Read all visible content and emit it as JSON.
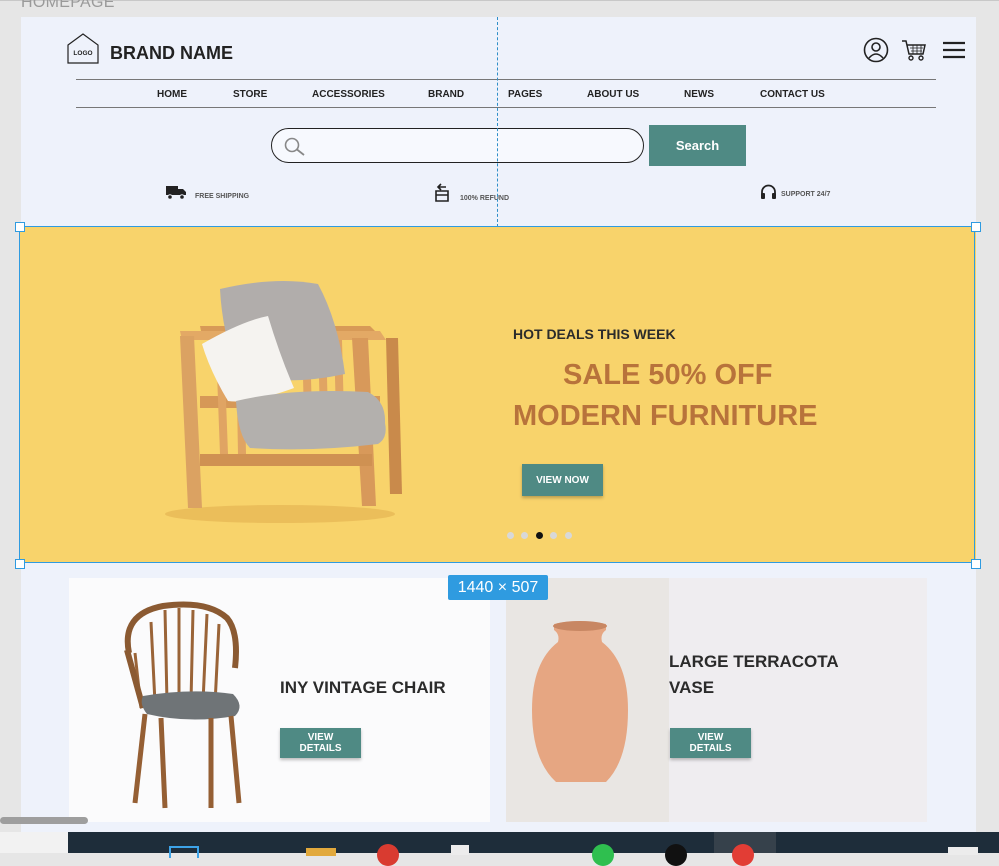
{
  "canvas": {
    "label": "HOMEPAGE",
    "size_badge": "1440 × 507"
  },
  "header": {
    "logo_text": "LOGO",
    "brand_name": "BRAND NAME",
    "icons": [
      "user-icon",
      "cart-icon",
      "menu-icon"
    ]
  },
  "nav": {
    "items": [
      {
        "label": "HOME"
      },
      {
        "label": "STORE"
      },
      {
        "label": "ACCESSORIES"
      },
      {
        "label": "BRAND"
      },
      {
        "label": "PAGES"
      },
      {
        "label": "ABOUT US"
      },
      {
        "label": "NEWS"
      },
      {
        "label": "CONTACT US"
      }
    ]
  },
  "search": {
    "placeholder": "",
    "value": "",
    "button_label": "Search"
  },
  "features": [
    {
      "icon": "truck-icon",
      "label": "FREE SHIPPING"
    },
    {
      "icon": "refund-icon",
      "label": "100% REFUND"
    },
    {
      "icon": "headset-icon",
      "label": "SUPPORT 24/7"
    }
  ],
  "hero": {
    "eyebrow": "HOT DEALS THIS WEEK",
    "headline_1": "SALE 50% OFF",
    "headline_2": "MODERN FURNITURE",
    "cta": "VIEW NOW",
    "slides_total": 5,
    "active_slide": 3,
    "background": "#f8d36b"
  },
  "products": [
    {
      "title": "INY VINTAGE CHAIR",
      "cta": "VIEW DETAILS"
    },
    {
      "title_line_1": "LARGE TERRACOTA",
      "title_line_2": "VASE",
      "cta": "VIEW DETAILS"
    }
  ],
  "colors": {
    "accent": "#4f8a84",
    "selection": "#2f9be0",
    "headline": "#b8733b"
  }
}
